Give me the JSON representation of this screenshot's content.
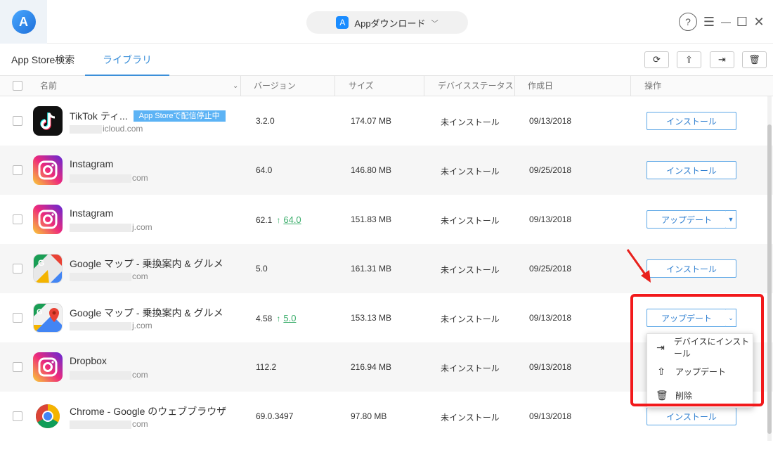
{
  "titlebar": {
    "app_dropdown_label": "Appダウンロード",
    "help_symbol": "?",
    "menu_symbol": "☰",
    "min_symbol": "—",
    "max_symbol": "☐",
    "close_symbol": "✕",
    "logo_letter": "A"
  },
  "tabs": {
    "search": "App Store検索",
    "library": "ライブラリ"
  },
  "toolbar": {
    "refresh": "⟳",
    "upload": "⇧",
    "install": "⇥",
    "delete": "🗑"
  },
  "table": {
    "headers": {
      "name": "名前",
      "version": "バージョン",
      "size": "サイズ",
      "status": "デバイスステータス",
      "date": "作成日",
      "action": "操作"
    },
    "rows": [
      {
        "name": "TikTok ティ...",
        "badge": "App Storeで配信停止中",
        "sub": "icloud.com",
        "version": "3.2.0",
        "size": "174.07 MB",
        "status": "未インストール",
        "date": "09/13/2018",
        "action": "インストール"
      },
      {
        "name": "Instagram",
        "sub": "com",
        "version": "64.0",
        "size": "146.80 MB",
        "status": "未インストール",
        "date": "09/25/2018",
        "action": "インストール"
      },
      {
        "name": "Instagram",
        "sub": "j.com",
        "version": "62.1",
        "up_arrow": "↑",
        "up_version": "64.0",
        "size": "151.83 MB",
        "status": "未インストール",
        "date": "09/13/2018",
        "action": "アップデート"
      },
      {
        "name": "Google マップ -  乗換案内 & グルメ",
        "sub": "com",
        "version": "5.0",
        "size": "161.31 MB",
        "status": "未インストール",
        "date": "09/25/2018",
        "action": "インストール"
      },
      {
        "name": "Google マップ -  乗換案内 & グルメ",
        "sub": "j.com",
        "version": "4.58",
        "up_arrow": "↑",
        "up_version": "5.0",
        "size": "153.13 MB",
        "status": "未インストール",
        "date": "09/13/2018",
        "action": "アップデート"
      },
      {
        "name": "Dropbox",
        "sub": "com",
        "version": "112.2",
        "size": "216.94 MB",
        "status": "未インストール",
        "date": "09/13/2018",
        "action": ""
      },
      {
        "name": "Chrome - Google のウェブブラウザ",
        "sub": "com",
        "version": "69.0.3497",
        "size": "97.80 MB",
        "status": "未インストール",
        "date": "09/13/2018",
        "action": "インストール"
      }
    ]
  },
  "menu": {
    "items": [
      {
        "icon": "⇥",
        "label": "デバイスにインストール"
      },
      {
        "icon": "⇧",
        "label": "アップデート"
      },
      {
        "icon": "🗑",
        "label": "削除"
      }
    ]
  },
  "colors": {
    "accent": "#3b8fd9",
    "update_green": "#3cae6c",
    "highlight_red": "#f2191b",
    "badge_blue": "#5cb3f5"
  }
}
